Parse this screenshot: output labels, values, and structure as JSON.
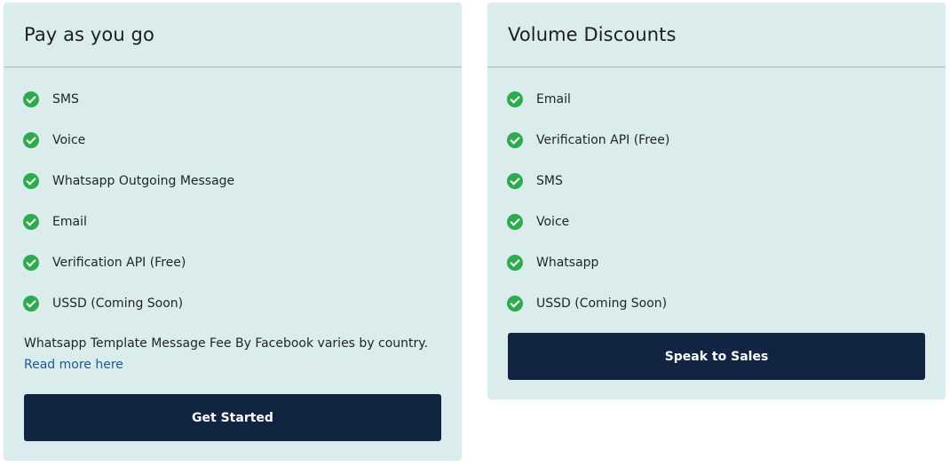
{
  "cards": [
    {
      "title": "Pay as you go",
      "features": [
        "SMS",
        "Voice",
        "Whatsapp Outgoing Message",
        "Email",
        "Verification API (Free)",
        "USSD (Coming Soon)"
      ],
      "note": "Whatsapp Template Message Fee By Facebook varies by country.",
      "link": "Read more here",
      "button": "Get Started"
    },
    {
      "title": "Volume Discounts",
      "features": [
        "Email",
        "Verification API (Free)",
        "SMS",
        "Voice",
        "Whatsapp",
        "USSD (Coming Soon)"
      ],
      "button": "Speak to Sales"
    }
  ],
  "colors": {
    "card_background": "#dbecec",
    "button_background": "#112543",
    "check_green": "#2eab4f",
    "link_blue": "#1c5a93"
  },
  "icons": {
    "feature_icon": "check-circle-icon"
  }
}
